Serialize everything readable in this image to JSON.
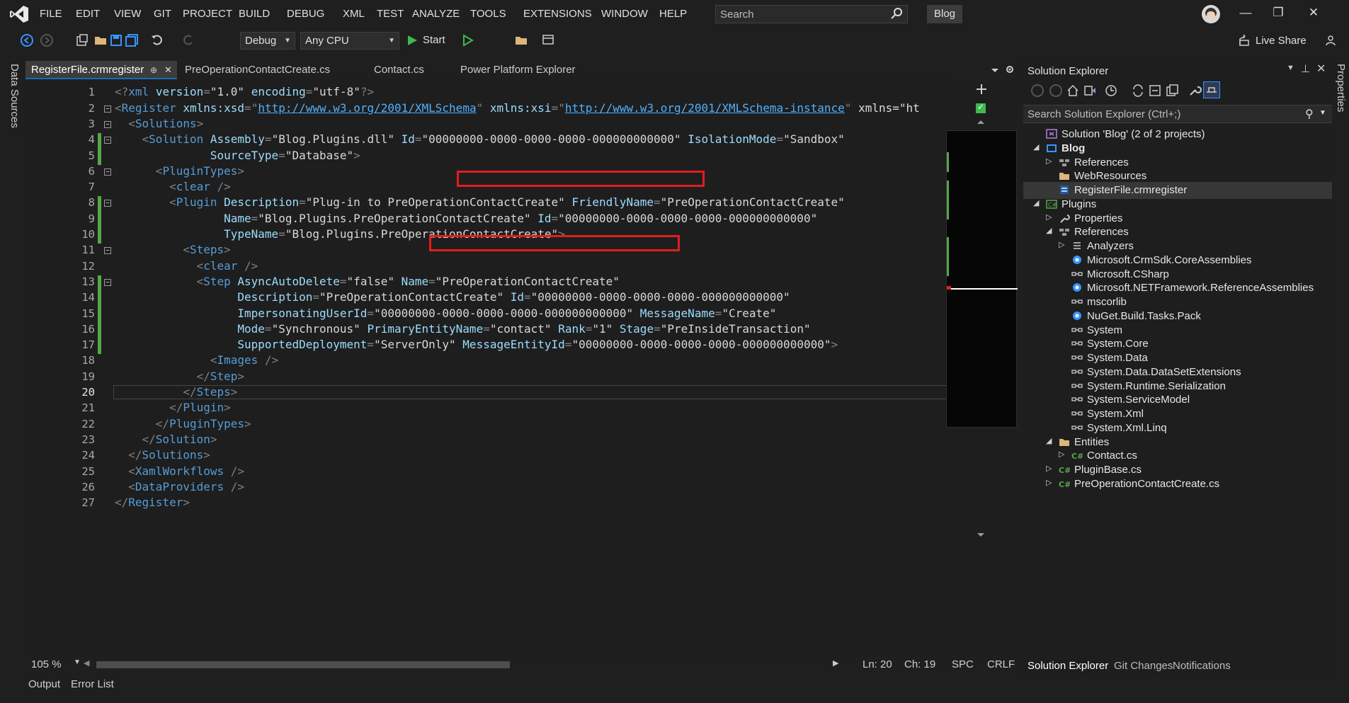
{
  "menubar": {
    "items": [
      "FILE",
      "EDIT",
      "VIEW",
      "GIT",
      "PROJECT",
      "BUILD",
      "DEBUG",
      "XML",
      "TEST",
      "ANALYZE",
      "TOOLS",
      "EXTENSIONS",
      "WINDOW",
      "HELP"
    ],
    "search_placeholder": "Search",
    "solution_badge": "Blog"
  },
  "toolbar": {
    "config": "Debug",
    "platform": "Any CPU",
    "start_label": "Start",
    "live_share": "Live Share"
  },
  "left_strip": {
    "label": "Data Sources"
  },
  "right_strip": {
    "label": "Properties"
  },
  "tabs": [
    {
      "label": "RegisterFile.crmregister",
      "active": true
    },
    {
      "label": "PreOperationContactCreate.cs"
    },
    {
      "label": "Contact.cs"
    },
    {
      "label": "Power Platform Explorer"
    }
  ],
  "editor": {
    "lines": [
      "<?xml version=\"1.0\" encoding=\"utf-8\"?>",
      "<Register xmlns:xsd=\"http://www.w3.org/2001/XMLSchema\" xmlns:xsi=\"http://www.w3.org/2001/XMLSchema-instance\" xmlns=\"ht",
      "  <Solutions>",
      "    <Solution Assembly=\"Blog.Plugins.dll\" Id=\"00000000-0000-0000-0000-000000000000\" IsolationMode=\"Sandbox\"",
      "              SourceType=\"Database\">",
      "      <PluginTypes>",
      "        <clear />",
      "        <Plugin Description=\"Plug-in to PreOperationContactCreate\" FriendlyName=\"PreOperationContactCreate\"",
      "                Name=\"Blog.Plugins.PreOperationContactCreate\" Id=\"00000000-0000-0000-0000-000000000000\"",
      "                TypeName=\"Blog.Plugins.PreOperationContactCreate\">",
      "          <Steps>",
      "            <clear />",
      "            <Step AsyncAutoDelete=\"false\" Name=\"PreOperationContactCreate\"",
      "                  Description=\"PreOperationContactCreate\" Id=\"00000000-0000-0000-0000-000000000000\"",
      "                  ImpersonatingUserId=\"00000000-0000-0000-0000-000000000000\" MessageName=\"Create\"",
      "                  Mode=\"Synchronous\" PrimaryEntityName=\"contact\" Rank=\"1\" Stage=\"PreInsideTransaction\"",
      "                  SupportedDeployment=\"ServerOnly\" MessageEntityId=\"00000000-0000-0000-0000-000000000000\">",
      "              <Images />",
      "            </Step>",
      "          </Steps>",
      "        </Plugin>",
      "      </PluginTypes>",
      "    </Solution>",
      "  </Solutions>",
      "  <XamlWorkflows />",
      "  <DataProviders />",
      "</Register>"
    ],
    "current_line": 20
  },
  "status": {
    "zoom": "105 %",
    "line": "Ln: 20",
    "col": "Ch: 19",
    "whitespace": "SPC",
    "eol": "CRLF"
  },
  "bottom_tabs": [
    "Output",
    "Error List"
  ],
  "solution_explorer": {
    "title": "Solution Explorer",
    "search_placeholder": "Search Solution Explorer (Ctrl+;)",
    "tree": [
      {
        "label": "Solution 'Blog' (2 of 2 projects)",
        "level": 0,
        "icon": "solution-icon"
      },
      {
        "label": "Blog",
        "level": 0,
        "expanded": true,
        "icon": "web-project-icon",
        "bold": true
      },
      {
        "label": "References",
        "level": 1,
        "expander": "collapsed",
        "icon": "references-icon"
      },
      {
        "label": "WebResources",
        "level": 1,
        "icon": "folder-icon"
      },
      {
        "label": "RegisterFile.crmregister",
        "level": 1,
        "icon": "crm-file-icon",
        "selected": true
      },
      {
        "label": "Plugins",
        "level": 0,
        "expanded": true,
        "icon": "csharp-project-icon"
      },
      {
        "label": "Properties",
        "level": 1,
        "expander": "collapsed",
        "icon": "wrench-icon"
      },
      {
        "label": "References",
        "level": 1,
        "expanded": true,
        "icon": "references-icon"
      },
      {
        "label": "Analyzers",
        "level": 2,
        "expander": "collapsed",
        "icon": "analyzer-icon"
      },
      {
        "label": "Microsoft.CrmSdk.CoreAssemblies",
        "level": 2,
        "icon": "nuget-icon"
      },
      {
        "label": "Microsoft.CSharp",
        "level": 2,
        "icon": "assembly-icon"
      },
      {
        "label": "Microsoft.NETFramework.ReferenceAssemblies",
        "level": 2,
        "icon": "nuget-icon"
      },
      {
        "label": "mscorlib",
        "level": 2,
        "icon": "assembly-icon"
      },
      {
        "label": "NuGet.Build.Tasks.Pack",
        "level": 2,
        "icon": "nuget-icon"
      },
      {
        "label": "System",
        "level": 2,
        "icon": "assembly-icon"
      },
      {
        "label": "System.Core",
        "level": 2,
        "icon": "assembly-icon"
      },
      {
        "label": "System.Data",
        "level": 2,
        "icon": "assembly-icon"
      },
      {
        "label": "System.Data.DataSetExtensions",
        "level": 2,
        "icon": "assembly-icon"
      },
      {
        "label": "System.Runtime.Serialization",
        "level": 2,
        "icon": "assembly-icon"
      },
      {
        "label": "System.ServiceModel",
        "level": 2,
        "icon": "assembly-icon"
      },
      {
        "label": "System.Xml",
        "level": 2,
        "icon": "assembly-icon"
      },
      {
        "label": "System.Xml.Linq",
        "level": 2,
        "icon": "assembly-icon"
      },
      {
        "label": "Entities",
        "level": 1,
        "expanded": true,
        "icon": "folder-icon"
      },
      {
        "label": "Contact.cs",
        "level": 2,
        "expander": "collapsed",
        "icon": "csharp-file-icon"
      },
      {
        "label": "PluginBase.cs",
        "level": 1,
        "expander": "collapsed",
        "icon": "csharp-file-icon"
      },
      {
        "label": "PreOperationContactCreate.cs",
        "level": 1,
        "expander": "collapsed",
        "icon": "csharp-file-icon"
      }
    ],
    "bottom_tabs": [
      "Solution Explorer",
      "Git Changes",
      "Notifications"
    ]
  },
  "colors": {
    "accent": "#0e70c0",
    "highlight_red": "#e01e1e",
    "added_line": "#57a64a",
    "xml_tag": "#569cd6",
    "xml_attr": "#9cdcfe"
  }
}
